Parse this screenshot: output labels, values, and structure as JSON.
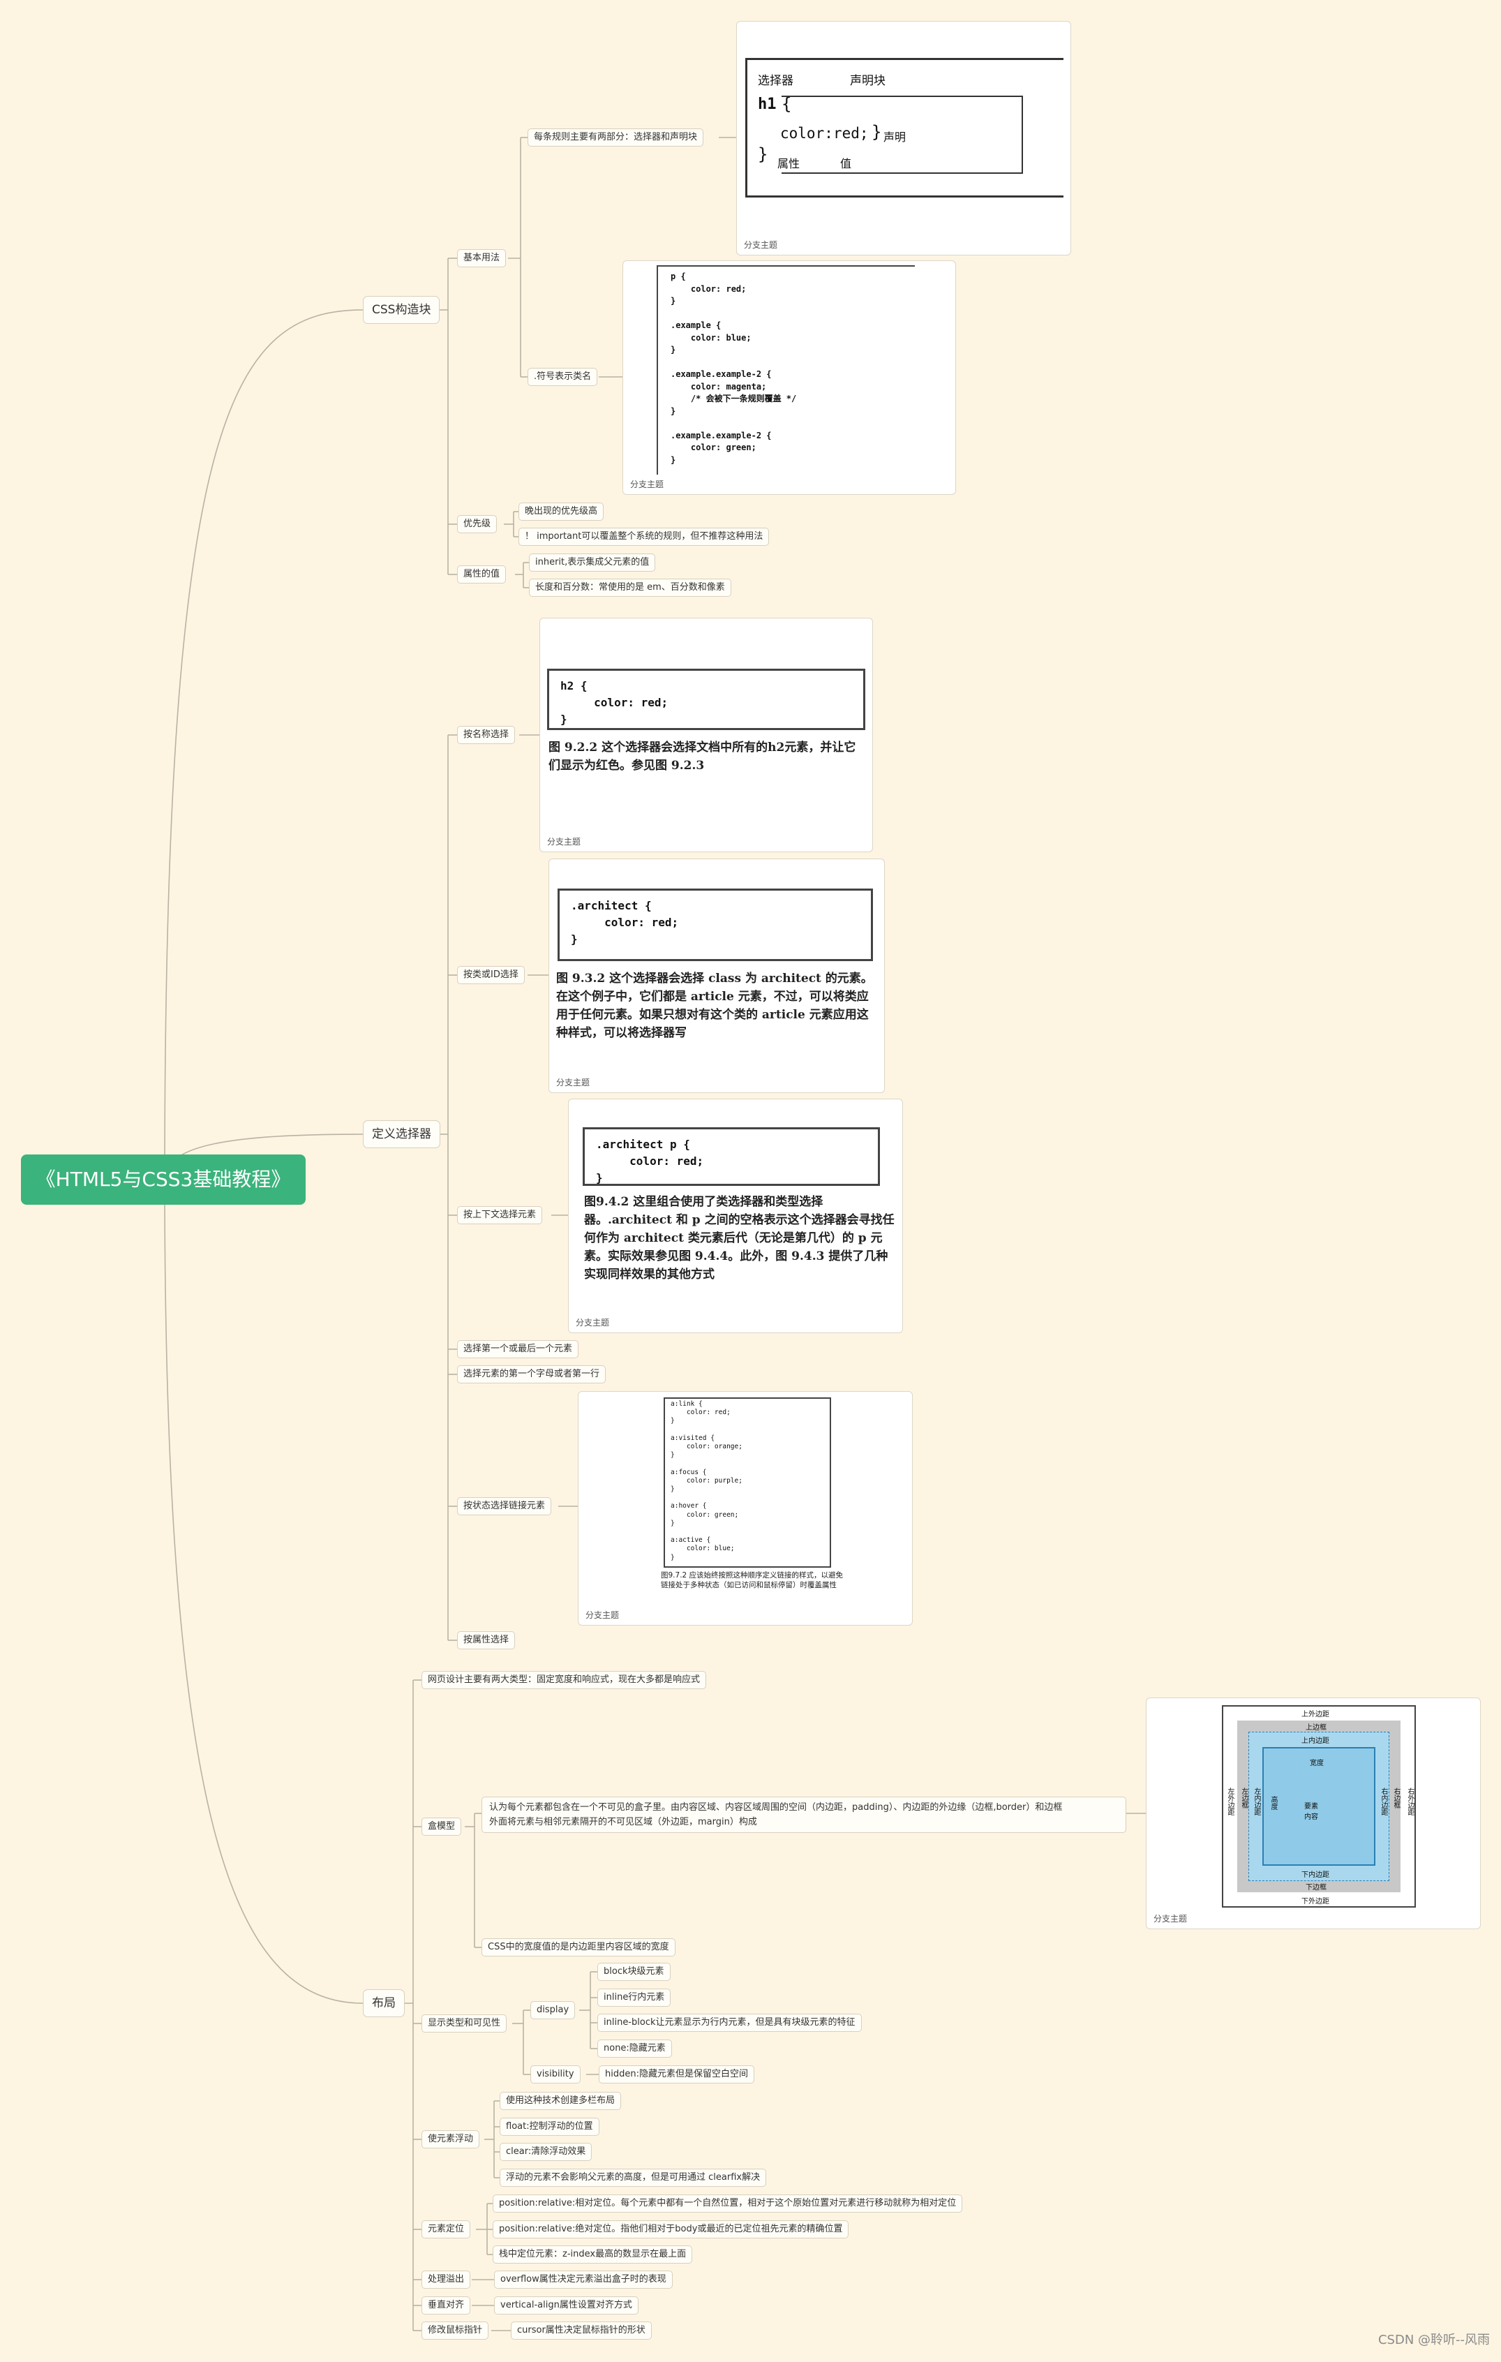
{
  "root": "《HTML5与CSS3基础教程》",
  "sections": {
    "css": "CSS构造块",
    "selectors": "定义选择器",
    "layout": "布局"
  },
  "css": {
    "basic": "基本用法",
    "rule_parts": "每条规则主要有两部分：选择器和声明块",
    "dot_class": ".符号表示类名",
    "priority": "优先级",
    "priority_items": [
      "晚出现的优先级高",
      "！ important可以覆盖整个系统的规则，但不推荐这种用法"
    ],
    "values": "属性的值",
    "value_items": [
      "inherit,表示集成父元素的值",
      "长度和百分数：常使用的是 em、百分数和像素"
    ]
  },
  "selectors": {
    "by_name": "按名称选择",
    "by_class_id": "按类或ID选择",
    "by_context": "按上下文选择元素",
    "first_last": "选择第一个或最后一个元素",
    "first_letter": "选择元素的第一个字母或者第一行",
    "by_state": "按状态选择链接元素",
    "by_attr": "按属性选择"
  },
  "layout": {
    "two_types": "网页设计主要有两大类型：固定宽度和响应式，现在大多都是响应式",
    "box_model": "盒模型",
    "box_desc_1": "认为每个元素都包含在一个不可见的盒子里。由内容区域、内容区域周围的空间（内边距，padding）、内边距的外边缘（边框,border）和边框",
    "box_desc_2": "外面将元素与相邻元素隔开的不可见区域（外边距，margin）构成",
    "box_width": "CSS中的宽度值的是内边距里内容区域的宽度",
    "display_vis": "显示类型和可见性",
    "display": "display",
    "display_items": [
      "block块级元素",
      "inline行内元素",
      "inline-block让元素显示为行内元素，但是具有块级元素的特征",
      "none:隐藏元素"
    ],
    "visibility": "visibility",
    "visibility_item": "hidden:隐藏元素但是保留空白空间",
    "float": "使元素浮动",
    "float_items": [
      "使用这种技术创建多栏布局",
      "float:控制浮动的位置",
      "clear:清除浮动效果",
      "浮动的元素不会影响父元素的高度，但是可用通过 clearfix解决"
    ],
    "position": "元素定位",
    "position_items": [
      "position:relative:相对定位。每个元素中都有一个自然位置，相对于这个原始位置对元素进行移动就称为相对定位",
      "position:relative:绝对定位。指他们相对于body或最近的已定位祖先元素的精确位置",
      "栈中定位元素：z-index最高的数显示在最上面"
    ],
    "overflow": "处理溢出",
    "overflow_item": "overflow属性决定元素溢出盒子时的表现",
    "valign": "垂直对齐",
    "valign_item": "vertical-align属性设置对齐方式",
    "cursor": "修改鼠标指针",
    "cursor_item": "cursor属性决定鼠标指针的形状"
  },
  "cards": {
    "caption": "分支主题",
    "rule_diagram": {
      "selector": "选择器",
      "decl_block": "声明块",
      "h1": "h1",
      "open": "{",
      "close": "}",
      "prop": "color:",
      "val": "red;",
      "declaration": "声明",
      "attr": "属性",
      "value": "值"
    },
    "class_code": "p {\n    color: red;\n}\n\n.example {\n    color: blue;\n}\n\n.example.example-2 {\n    color: magenta;\n    /* 会被下一条规则覆盖 */\n}\n\n.example.example-2 {\n    color: green;\n}",
    "h2_code": "h2 {\n     color: red;\n}",
    "h2_caption": "图 9.2.2   这个选择器会选择文档中所有的h2元素，并让它们显示为红色。参见图 9.2.3",
    "arch_code": ".architect {\n     color: red;\n}",
    "arch_caption": "图 9.3.2   这个选择器会选择 class 为 architect 的元素。在这个例子中，它们都是 article 元素，不过，可以将类应用于任何元素。如果只想对有这个类的 article 元素应用这种样式，可以将选择器写",
    "ctx_code": ".architect p {\n     color: red;\n}",
    "ctx_caption": "图9.4.2   这里组合使用了类选择器和类型选择器。.architect 和 p 之间的空格表示这个选择器会寻找任何作为 architect 类元素后代（无论是第几代）的 p 元素。实际效果参见图 9.4.4。此外，图 9.4.3 提供了几种实现同样效果的其他方式",
    "link_code": "a:link {\n    color: red;\n}\n\na:visited {\n    color: orange;\n}\n\na:focus {\n    color: purple;\n}\n\na:hover {\n    color: green;\n}\n\na:active {\n    color: blue;\n}",
    "link_caption": "图9.7.2   应该始终按照这种顺序定义链接的样式，以避免链接处于多种状态（如已访问和鼠标停留）时覆盖属性",
    "box": {
      "margin_top": "上外边距",
      "margin_bottom": "下外边距",
      "margin_left": "左外边距",
      "margin_right": "右外边距",
      "border_top": "上边框",
      "border_bottom": "下边框",
      "border_left": "左边框",
      "border_right": "右边框",
      "padding_top": "上内边距",
      "padding_bottom": "下内边距",
      "padding_left": "左内边距",
      "padding_right": "右内边距",
      "width": "宽度",
      "height": "高度",
      "content": "要素内容"
    }
  },
  "watermark": "CSDN @聆听--风雨"
}
